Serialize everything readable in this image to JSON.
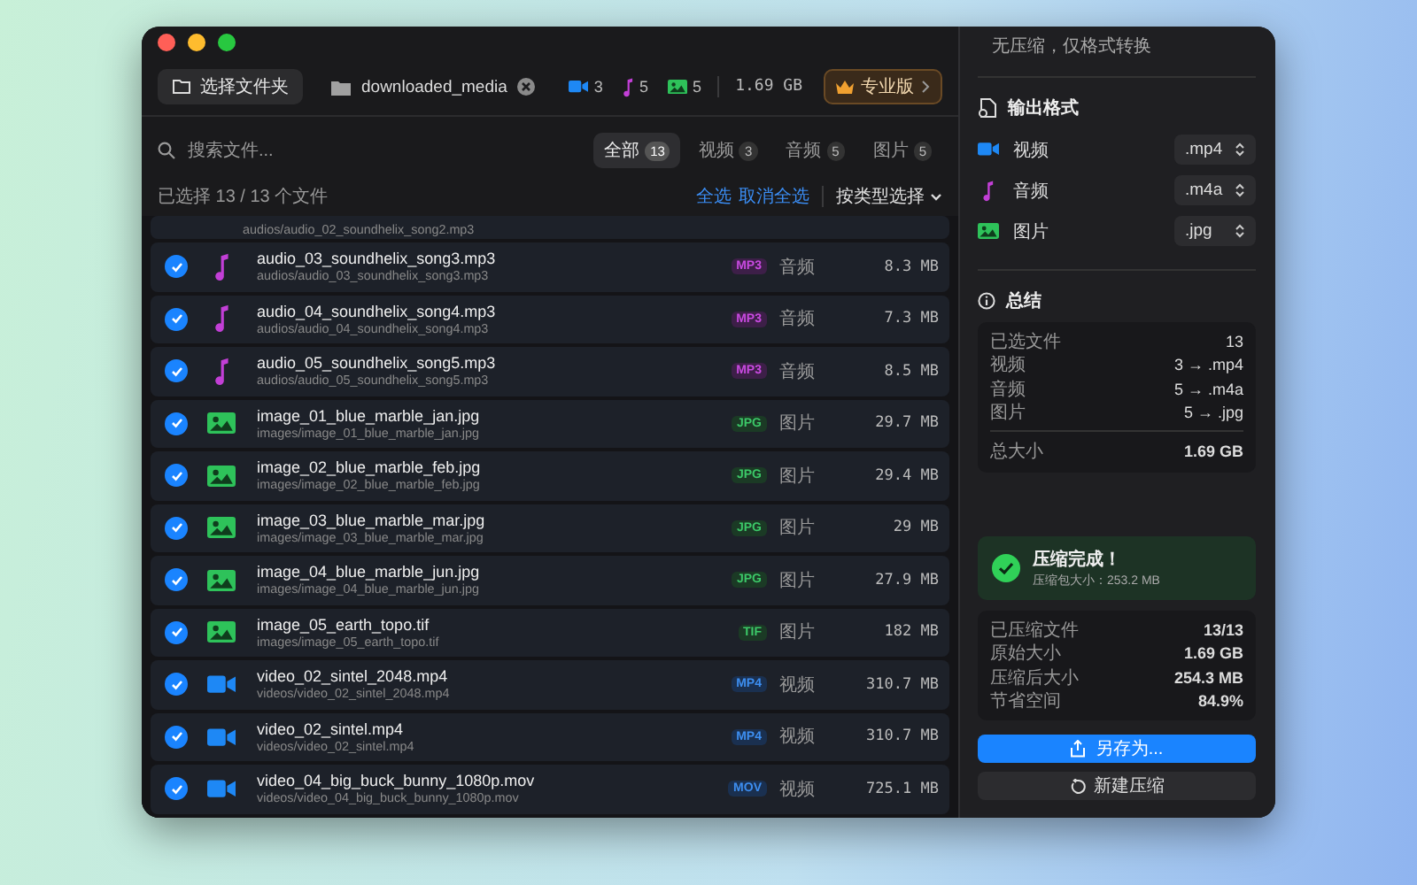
{
  "toolbar": {
    "folder_button": "选择文件夹",
    "folder_name": "downloaded_media",
    "counts": [
      {
        "kind": "video",
        "value": "3"
      },
      {
        "kind": "audio",
        "value": "5"
      },
      {
        "kind": "image",
        "value": "5"
      }
    ],
    "total_size": "1.69 GB",
    "pro_button": "专业版"
  },
  "search": {
    "placeholder": "搜索文件..."
  },
  "filters": [
    {
      "label": "全部",
      "count": "13",
      "selected": true
    },
    {
      "label": "视频",
      "count": "3",
      "selected": false
    },
    {
      "label": "音频",
      "count": "5",
      "selected": false
    },
    {
      "label": "图片",
      "count": "5",
      "selected": false
    }
  ],
  "selection": {
    "status": "已选择 13 / 13 个文件",
    "select_all": "全选",
    "deselect_all": "取消全选",
    "select_by_type": "按类型选择"
  },
  "files": [
    {
      "path": "audios/audio_02_soundhelix_song2.mp3"
    },
    {
      "kind": "audio",
      "checked": true,
      "name": "audio_03_soundhelix_song3.mp3",
      "path": "audios/audio_03_soundhelix_song3.mp3",
      "format": "MP3",
      "type_label": "音频",
      "size": "8.3 MB"
    },
    {
      "kind": "audio",
      "checked": true,
      "name": "audio_04_soundhelix_song4.mp3",
      "path": "audios/audio_04_soundhelix_song4.mp3",
      "format": "MP3",
      "type_label": "音频",
      "size": "7.3 MB"
    },
    {
      "kind": "audio",
      "checked": true,
      "name": "audio_05_soundhelix_song5.mp3",
      "path": "audios/audio_05_soundhelix_song5.mp3",
      "format": "MP3",
      "type_label": "音频",
      "size": "8.5 MB"
    },
    {
      "kind": "image",
      "checked": true,
      "name": "image_01_blue_marble_jan.jpg",
      "path": "images/image_01_blue_marble_jan.jpg",
      "format": "JPG",
      "type_label": "图片",
      "size": "29.7 MB"
    },
    {
      "kind": "image",
      "checked": true,
      "name": "image_02_blue_marble_feb.jpg",
      "path": "images/image_02_blue_marble_feb.jpg",
      "format": "JPG",
      "type_label": "图片",
      "size": "29.4 MB"
    },
    {
      "kind": "image",
      "checked": true,
      "name": "image_03_blue_marble_mar.jpg",
      "path": "images/image_03_blue_marble_mar.jpg",
      "format": "JPG",
      "type_label": "图片",
      "size": "29 MB"
    },
    {
      "kind": "image",
      "checked": true,
      "name": "image_04_blue_marble_jun.jpg",
      "path": "images/image_04_blue_marble_jun.jpg",
      "format": "JPG",
      "type_label": "图片",
      "size": "27.9 MB"
    },
    {
      "kind": "image",
      "checked": true,
      "name": "image_05_earth_topo.tif",
      "path": "images/image_05_earth_topo.tif",
      "format": "TIF",
      "type_label": "图片",
      "size": "182 MB"
    },
    {
      "kind": "video",
      "checked": true,
      "name": "video_02_sintel_2048.mp4",
      "path": "videos/video_02_sintel_2048.mp4",
      "format": "MP4",
      "type_label": "视频",
      "size": "310.7 MB"
    },
    {
      "kind": "video",
      "checked": true,
      "name": "video_02_sintel.mp4",
      "path": "videos/video_02_sintel.mp4",
      "format": "MP4",
      "type_label": "视频",
      "size": "310.7 MB"
    },
    {
      "kind": "video",
      "checked": true,
      "name": "video_04_big_buck_bunny_1080p.mov",
      "path": "videos/video_04_big_buck_bunny_1080p.mov",
      "format": "MOV",
      "type_label": "视频",
      "size": "725.1 MB"
    }
  ],
  "panel": {
    "mode_description": "无压缩，仅格式转换",
    "output_format": {
      "title": "输出格式",
      "rows": [
        {
          "kind": "video",
          "label": "视频",
          "value": ".mp4"
        },
        {
          "kind": "audio",
          "label": "音频",
          "value": ".m4a"
        },
        {
          "kind": "image",
          "label": "图片",
          "value": ".jpg"
        }
      ]
    },
    "summary": {
      "title": "总结",
      "rows": [
        {
          "label": "已选文件",
          "value": "13"
        },
        {
          "label": "视频",
          "value": "3 → .mp4"
        },
        {
          "label": "音频",
          "value": "5 → .m4a"
        },
        {
          "label": "图片",
          "value": "5 → .jpg"
        }
      ],
      "total": {
        "label": "总大小",
        "value": "1.69 GB"
      }
    },
    "result": {
      "title": "压缩完成！",
      "detail": "压缩包大小：253.2 MB"
    },
    "stats": [
      {
        "label": "已压缩文件",
        "value": "13/13"
      },
      {
        "label": "原始大小",
        "value": "1.69 GB"
      },
      {
        "label": "压缩后大小",
        "value": "254.3 MB"
      },
      {
        "label": "节省空间",
        "value": "84.9%"
      }
    ],
    "save_button": "另存为...",
    "new_button": "新建压缩"
  }
}
